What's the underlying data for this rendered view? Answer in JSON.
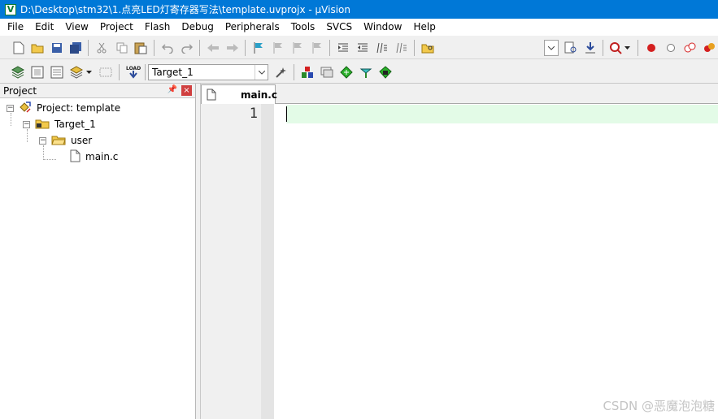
{
  "titlebar": {
    "app_icon_letter": "V",
    "title": "D:\\Desktop\\stm32\\1.点亮LED灯寄存器写法\\template.uvprojx - µVision"
  },
  "menu": [
    "File",
    "Edit",
    "View",
    "Project",
    "Flash",
    "Debug",
    "Peripherals",
    "Tools",
    "SVCS",
    "Window",
    "Help"
  ],
  "toolbar2": {
    "target_select": "Target_1",
    "load_label": "LOAD"
  },
  "project_panel": {
    "title": "Project",
    "tree": {
      "root": "Project: template",
      "target": "Target_1",
      "group": "user",
      "file": "main.c"
    }
  },
  "editor": {
    "tab_label": "main.c",
    "line_numbers": [
      "1"
    ]
  },
  "watermark": "CSDN @恶魔泡泡糖",
  "colors": {
    "titlebar": "#0078d7",
    "current_line": "#e3fbe7",
    "breakpoint_red": "#d42020"
  }
}
